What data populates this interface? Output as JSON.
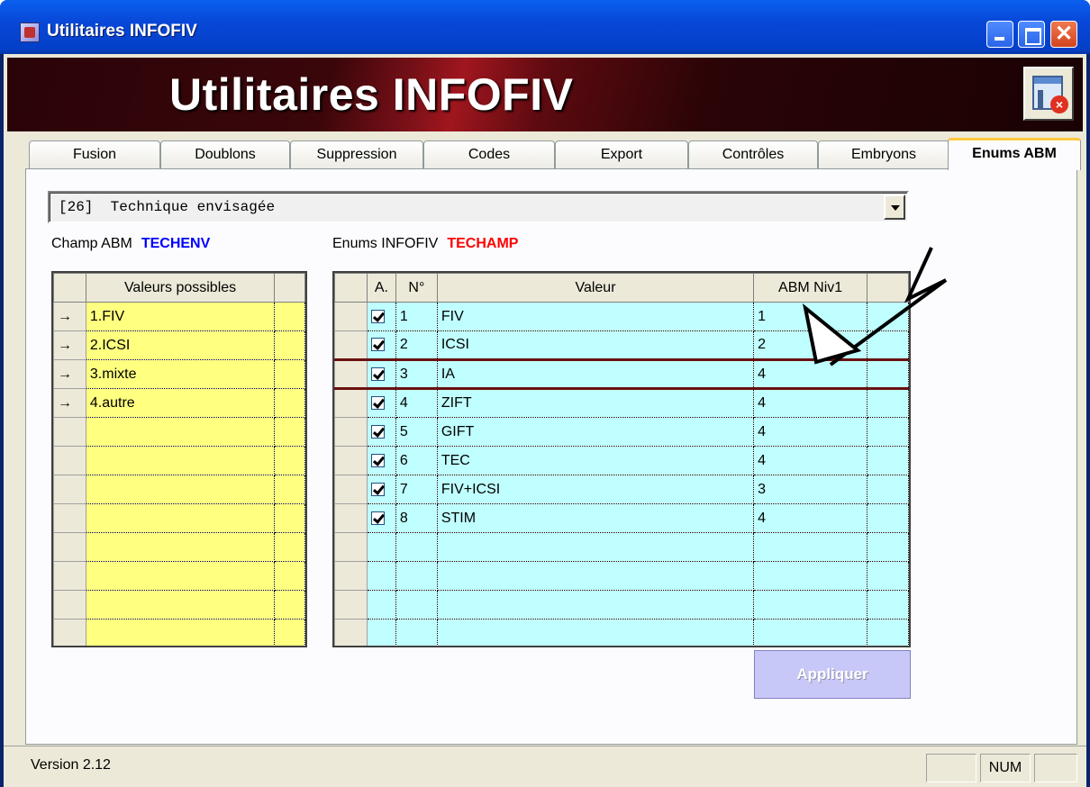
{
  "window": {
    "title": "Utilitaires INFOFIV",
    "banner_title": "Utilitaires INFOFIV"
  },
  "tabs": [
    {
      "label": "Fusion"
    },
    {
      "label": "Doublons"
    },
    {
      "label": "Suppression"
    },
    {
      "label": "Codes"
    },
    {
      "label": "Export"
    },
    {
      "label": "Contrôles"
    },
    {
      "label": "Embryons"
    },
    {
      "label": "Enums ABM",
      "active": true
    }
  ],
  "combo": {
    "selected": "[26]  Technique envisagée"
  },
  "champ_abm": {
    "label": "Champ ABM",
    "code": "TECHENV",
    "code_color": "#0000ff"
  },
  "enums_infofiv": {
    "label": "Enums INFOFIV",
    "code": "TECHAMP",
    "code_color": "#ff0000"
  },
  "left_grid": {
    "header": "Valeurs possibles",
    "rows": [
      "1.FIV",
      "2.ICSI",
      "3.mixte",
      "4.autre",
      "",
      "",
      "",
      "",
      "",
      "",
      "",
      ""
    ]
  },
  "right_grid": {
    "headers": {
      "a": "A.",
      "n": "N°",
      "valeur": "Valeur",
      "abm": "ABM Niv1"
    },
    "rows": [
      {
        "checked": true,
        "n": "1",
        "valeur": "FIV",
        "abm": "1"
      },
      {
        "checked": true,
        "n": "2",
        "valeur": "ICSI",
        "abm": "2"
      },
      {
        "checked": true,
        "n": "3",
        "valeur": "IA",
        "abm": "4",
        "selected": true
      },
      {
        "checked": true,
        "n": "4",
        "valeur": "ZIFT",
        "abm": "4"
      },
      {
        "checked": true,
        "n": "5",
        "valeur": "GIFT",
        "abm": "4"
      },
      {
        "checked": true,
        "n": "6",
        "valeur": "TEC",
        "abm": "4"
      },
      {
        "checked": true,
        "n": "7",
        "valeur": "FIV+ICSI",
        "abm": "3"
      },
      {
        "checked": true,
        "n": "8",
        "valeur": "STIM",
        "abm": "4"
      },
      {
        "checked": false,
        "n": "",
        "valeur": "",
        "abm": ""
      },
      {
        "checked": false,
        "n": "",
        "valeur": "",
        "abm": ""
      },
      {
        "checked": false,
        "n": "",
        "valeur": "",
        "abm": ""
      },
      {
        "checked": false,
        "n": "",
        "valeur": "",
        "abm": ""
      }
    ]
  },
  "apply_button": {
    "label": "Appliquer",
    "disabled": true
  },
  "statusbar": {
    "version": "Version 2.12",
    "num": "NUM"
  },
  "icons": {
    "app": "app-icon",
    "exit": "exit-window-icon",
    "row_marker": "arrow-right-icon",
    "checkbox": "checkmark-icon",
    "annotation": "annotation-arrow-icon"
  }
}
